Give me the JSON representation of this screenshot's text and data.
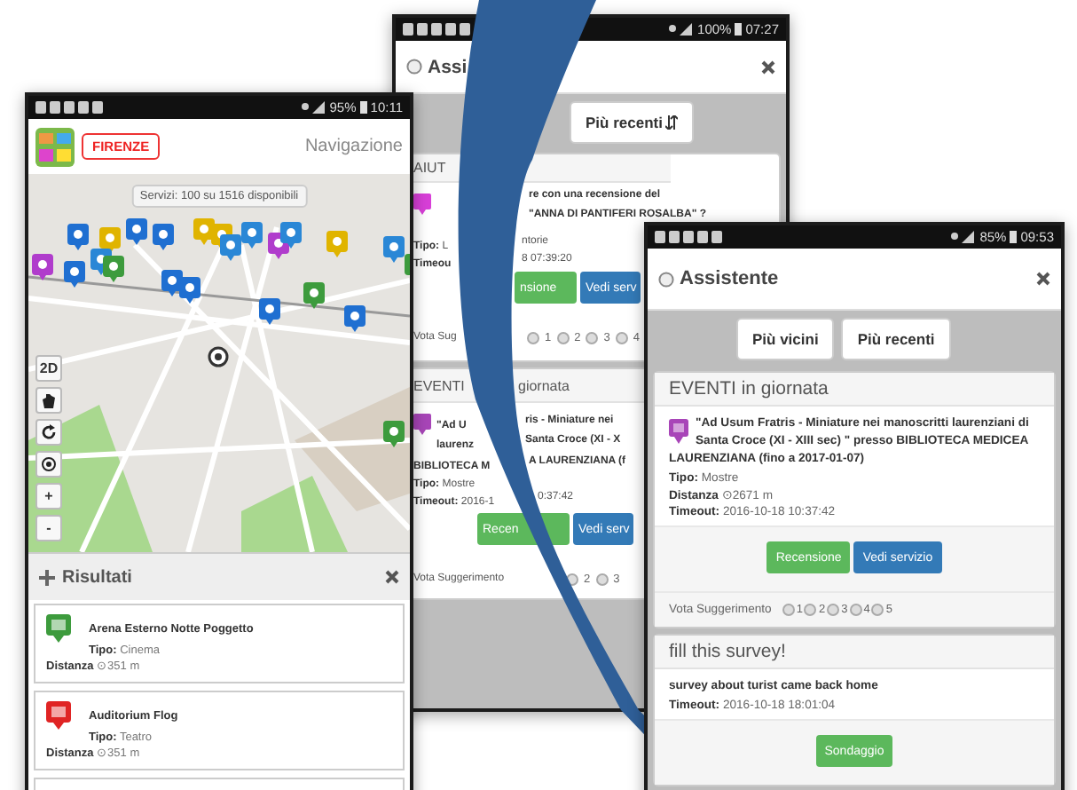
{
  "navigation_phone": {
    "status": {
      "battery": "95%",
      "time": "10:11"
    },
    "city": "FIRENZE",
    "title": "Navigazione",
    "map": {
      "tooltip": "Servizi: 100 su 1516 disponibili",
      "view_button": "2D",
      "zoom_in": "+",
      "zoom_out": "-"
    },
    "results": {
      "title": "Risultati",
      "more_items_below": true,
      "items": [
        {
          "name": "Arena Esterno Notte Poggetto",
          "type": "**Tipo:** Cinema",
          "distance": "**Distanza** ⊙351 m",
          "color": "#3d9b3d"
        },
        {
          "name": "Auditorium Flog",
          "type": "**Tipo:** Teatro",
          "distance": "**Distanza** ⊙351 m",
          "color": "#e02424"
        }
      ]
    }
  },
  "assistant_back": {
    "status": {
      "battery": "100%",
      "time": "07:27"
    },
    "title": "Assi",
    "tab": "Più recenti",
    "sections": [
      {
        "rows": [
          {
            "kind": "header",
            "left": "AIUT"
          },
          {
            "kind": "icon_title",
            "color": "#d83fd8",
            "lines": [
              {
                "right": "re con una recensione del"
              },
              {
                "right": "\"ANNA DI PANTIFERI ROSALBA\" ?"
              }
            ]
          },
          {
            "kind": "text",
            "left": "**Tipo:** L",
            "right": "ntorie"
          },
          {
            "kind": "text",
            "left": "**Timeou**",
            "right": "8 07:39:20"
          },
          {
            "kind": "buttons",
            "buttons": [
              {
                "label": "nsione",
                "kind": "success"
              },
              {
                "label": "Vedi serv",
                "kind": "primary"
              }
            ]
          },
          {
            "kind": "vote",
            "left": "Vota Sug",
            "options": [
              {
                "label": "1",
                "selected": false
              },
              {
                "label": "2",
                "selected": false
              },
              {
                "label": "3",
                "selected": false
              },
              {
                "label": "4",
                "selected": false
              }
            ]
          }
        ]
      },
      {
        "rows": [
          {
            "kind": "header",
            "left": "EVENTI",
            "right": "giornata"
          },
          {
            "kind": "icon_title",
            "color": "#a845b8",
            "lines": [
              {
                "left": "\"Ad U",
                "right": "ris - Miniature nei"
              },
              {
                "left": "laurenz",
                "right": "Santa Croce (XI - X"
              }
            ]
          },
          {
            "kind": "title",
            "left": "BIBLIOTECA M",
            "right": "A LAURENZIANA (f"
          },
          {
            "kind": "text",
            "left": "**Tipo:** Mostre"
          },
          {
            "kind": "text",
            "left": "**Timeout:** 2016-1",
            "right": "0:37:42"
          },
          {
            "kind": "buttons",
            "buttons": [
              {
                "label": "Recen",
                "kind": "success"
              },
              {
                "label": "Vedi serv",
                "kind": "primary"
              }
            ]
          },
          {
            "kind": "vote",
            "left": "Vota Suggerimento",
            "options": [
              {
                "label": "2",
                "selected": false
              },
              {
                "label": "3",
                "selected": false
              }
            ]
          }
        ]
      }
    ]
  },
  "assistant_front": {
    "status": {
      "battery": "85%",
      "time": "09:53"
    },
    "title": "Assistente",
    "tabs": [
      "Più vicini",
      "Più recenti"
    ],
    "cards": [
      {
        "kind": "event",
        "header": "EVENTI in giornata",
        "color": "#a845b8",
        "title": "\"Ad Usum Fratris - Miniature nei manoscritti laurenziani di Santa Croce (XI - XIII sec) \" presso BIBLIOTECA MEDICEA LAURENZIANA (fino a 2017-01-07)",
        "fields": [
          "**Tipo:** Mostre",
          "**Distanza** ⊙2671 m",
          "**Timeout:** 2016-10-18 10:37:42"
        ],
        "buttons": [
          {
            "label": "Recensione",
            "kind": "success"
          },
          {
            "label": "Vedi servizio",
            "kind": "primary"
          }
        ],
        "vote": {
          "label": "Vota Suggerimento",
          "options": [
            {
              "label": "1",
              "selected": false
            },
            {
              "label": "2",
              "selected": false
            },
            {
              "label": "3",
              "selected": false
            },
            {
              "label": "4",
              "selected": false
            },
            {
              "label": "5",
              "selected": false
            }
          ]
        }
      },
      {
        "kind": "survey",
        "header": "fill this survey!",
        "title": "survey about turist came back home",
        "fields": [
          "**Timeout:** 2016-10-18 18:01:04"
        ],
        "buttons": [
          {
            "label": "Sondaggio",
            "kind": "success"
          }
        ]
      }
    ]
  }
}
